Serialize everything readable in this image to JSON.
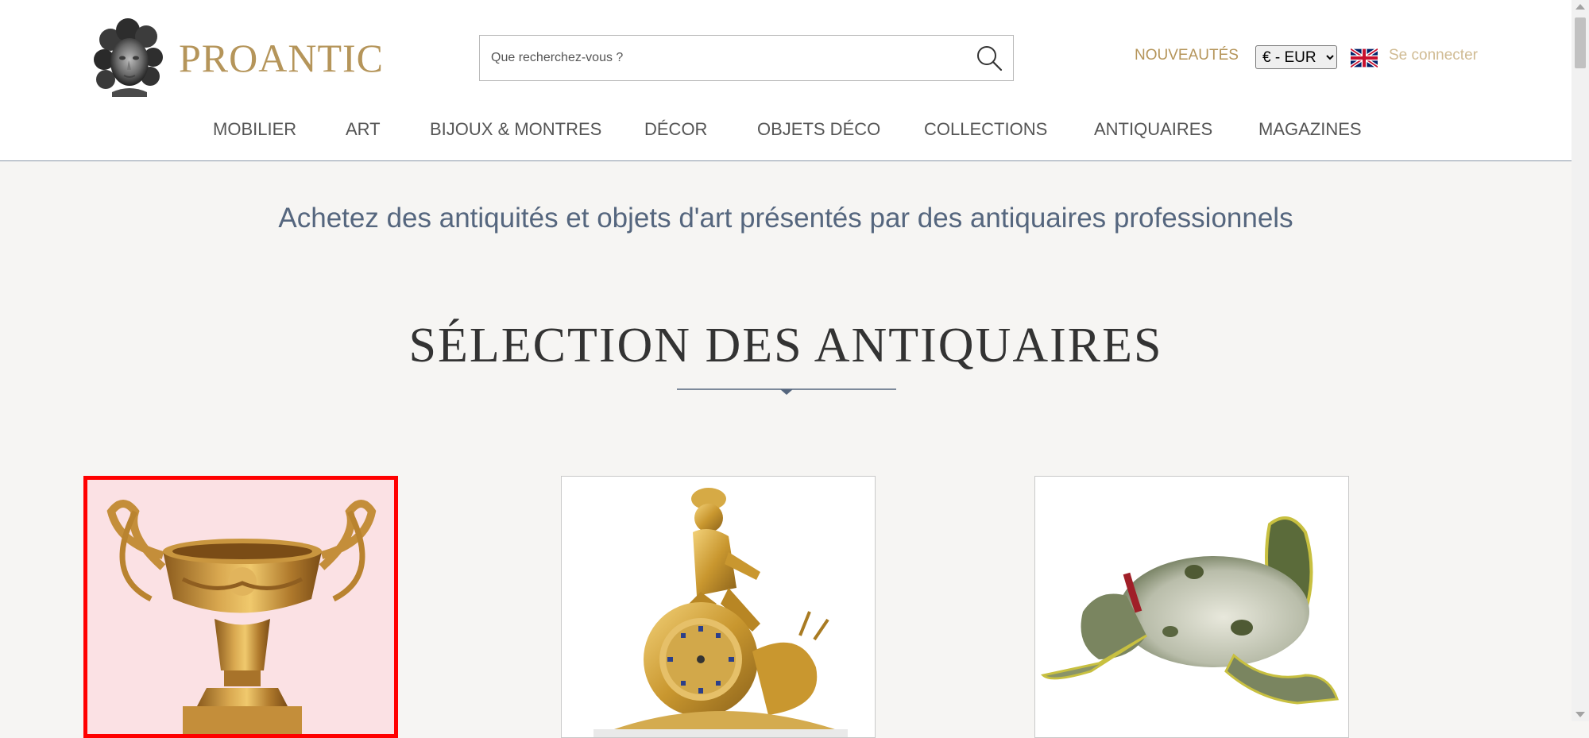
{
  "brand": {
    "name": "PROANTIC",
    "logo_icon": "sculpted-head-icon"
  },
  "header": {
    "search_placeholder": "Que recherchez-vous ?",
    "search_icon": "search-icon",
    "new_label": "NOUVEAUTÉS",
    "currency_selected": "€ - EUR",
    "language_icon": "uk-flag-icon",
    "login_label": "Se connecter"
  },
  "nav": {
    "items": [
      {
        "label": "MOBILIER"
      },
      {
        "label": "ART"
      },
      {
        "label": "BIJOUX & MONTRES"
      },
      {
        "label": "DÉCOR"
      },
      {
        "label": "OBJETS DÉCO"
      },
      {
        "label": "COLLECTIONS"
      },
      {
        "label": "ANTIQUAIRES"
      },
      {
        "label": "MAGAZINES"
      }
    ]
  },
  "main": {
    "tagline": "Achetez des antiquités et objets d'art présentés par des antiquaires professionnels",
    "section_title": "SÉLECTION DES ANTIQUAIRES",
    "products": [
      {
        "image": "gilt-bronze-urn-image",
        "highlighted": true
      },
      {
        "image": "gilt-bronze-clock-image",
        "highlighted": false
      },
      {
        "image": "ceramic-frog-image",
        "highlighted": false
      }
    ]
  },
  "colors": {
    "brand_gold": "#b5955a",
    "text_blue_gray": "#55667e",
    "highlight_red": "#ff0000",
    "page_background": "#f6f5f3"
  }
}
